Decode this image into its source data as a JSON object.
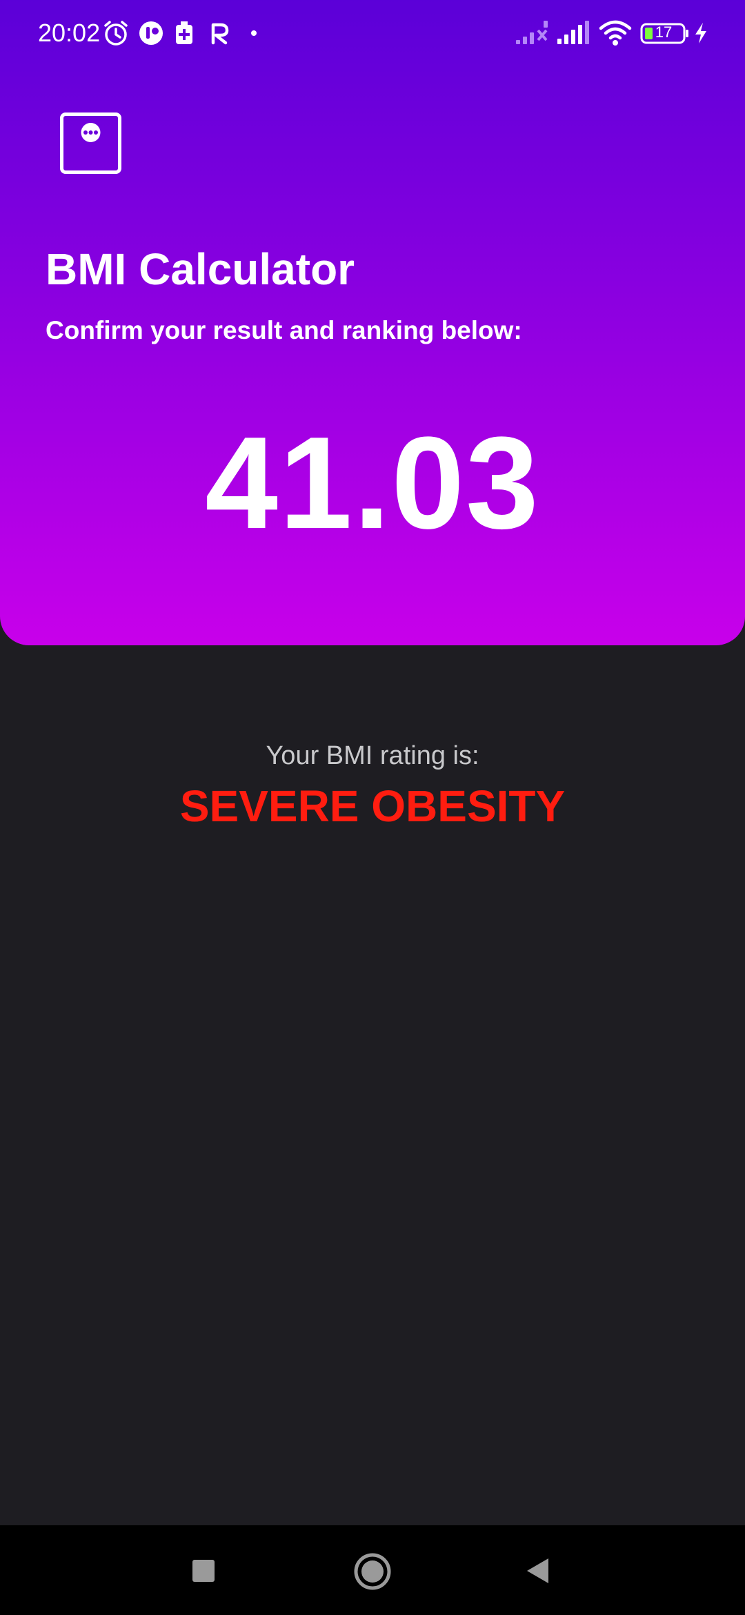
{
  "status_bar": {
    "time": "20:02",
    "battery_level": "17",
    "icons": [
      "alarm-icon",
      "app-notification-icon",
      "battery-saver-icon",
      "r-app-icon",
      "dot-icon",
      "signal-no-service-icon",
      "signal-icon",
      "wifi-icon",
      "battery-icon",
      "charging-icon"
    ]
  },
  "header": {
    "menu_icon": "chat-bubble-icon",
    "title": "BMI Calculator",
    "subtitle": "Confirm your result and ranking below:",
    "bmi_value": "41.03",
    "colors": {
      "gradient_top": "#5b00d8",
      "gradient_bottom": "#c800ea"
    }
  },
  "result": {
    "label": "Your BMI rating is:",
    "rating": "SEVERE OBESITY",
    "rating_color": "#ff1d10"
  },
  "nav_bar": {
    "buttons": [
      "recents-button",
      "home-button",
      "back-button"
    ]
  }
}
